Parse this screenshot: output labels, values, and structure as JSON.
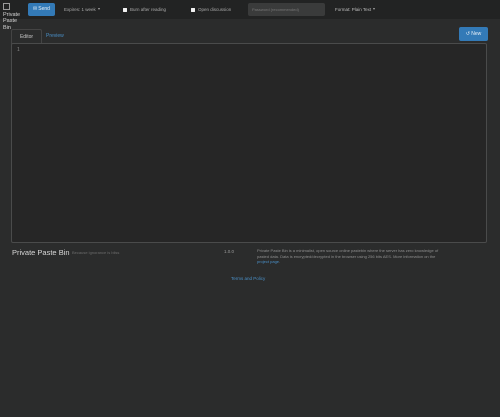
{
  "brand": {
    "logo_alt": "Private Paste Bin"
  },
  "nav": {
    "send_label": "Send",
    "expire_label": "Expires: 1 week",
    "burn_label": "Burn after reading",
    "discussion_label": "Open discussion",
    "password_placeholder": "Password (recommended)",
    "format_label": "Format: Plain Text"
  },
  "tabs": [
    {
      "label": "Editor"
    },
    {
      "label": "Preview"
    }
  ],
  "actions": {
    "new_label": "New"
  },
  "editor": {
    "line_number": "1"
  },
  "footer": {
    "title": "Private Paste Bin",
    "subtitle": "Because ignorance is bliss",
    "version": "1.0.0",
    "about_text": "Private Paste Bin is a minimalist, open source online pastebin where the server has zero knowledge of pasted data. Data is encrypted/decrypted in the browser using 256 bits AES. More information on the",
    "about_link": "project page",
    "center_link": "Terms and Policy"
  },
  "colors": {
    "background": "#2b2c2c",
    "navbar": "#222323",
    "primary_button": "#337ab7",
    "link": "#4a90c8",
    "editor_bg": "#262626"
  }
}
